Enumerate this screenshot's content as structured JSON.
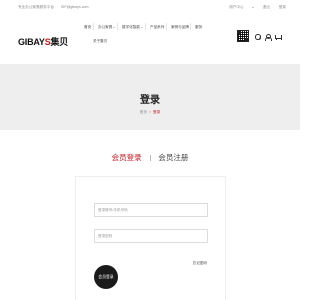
{
  "topbar": {
    "slogan": "专业办公家具服务平台",
    "email": "ISP@gibays.com",
    "user_center": "用户中心",
    "logout": "退出",
    "login": "登录"
  },
  "header": {
    "logo_text_prefix": "GIBAY",
    "logo_text_s": "S",
    "logo_text_cn": "集贝",
    "nav": [
      {
        "label": "首页"
      },
      {
        "label": "办公家具"
      },
      {
        "label": "楼宇化智能"
      },
      {
        "label": "产品系列"
      },
      {
        "label": "案例与品牌"
      },
      {
        "label": "服务"
      },
      {
        "label": "关于集贝"
      }
    ],
    "icons": [
      "qr-code",
      "search-icon",
      "user-icon",
      "cart-icon"
    ]
  },
  "banner": {
    "title": "登录",
    "breadcrumb_home": "首页",
    "breadcrumb_sep": ">",
    "breadcrumb_current": "登录"
  },
  "tabs": {
    "login": "会员登录",
    "register": "会员注册"
  },
  "form": {
    "username_placeholder": "登录账号/手机号码",
    "password_placeholder": "登录密码",
    "forgot": "忘记密码",
    "login_button": "会员登录"
  },
  "colors": {
    "accent": "#c4161c",
    "banner_bg": "#eeeeee",
    "button_bg": "#1a1a1a"
  }
}
